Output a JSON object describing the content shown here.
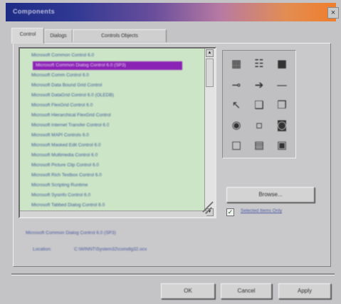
{
  "window": {
    "title": "Components",
    "close_glyph": "×"
  },
  "tabs": [
    {
      "label": "Control"
    },
    {
      "label": "Dialogs"
    },
    {
      "label": "Controls Objects"
    }
  ],
  "list": {
    "items": [
      "Microsoft Common Control 6.0",
      "Microsoft Common Dialog Control 6.0 (SP3)",
      "Microsoft Comm Control 6.0",
      "Microsoft Data Bound Grid Control",
      "Microsoft DataGrid Control 6.0 (OLEDB)",
      "Microsoft FlexGrid Control 6.0",
      "Microsoft Hierarchical FlexGrid Control",
      "Microsoft Internet Transfer Control 6.0",
      "Microsoft MAPI Controls 6.0",
      "Microsoft Masked Edit Control 6.0",
      "Microsoft Multimedia Control 6.0",
      "Microsoft Picture Clip Control 6.0",
      "Microsoft Rich Textbox Control 6.0",
      "Microsoft Scripting Runtime",
      "Microsoft Sysinfo Control 6.0",
      "Microsoft Tabbed Dialog Control 6.0"
    ],
    "selected_index": 1
  },
  "icons": [
    "grid-icon",
    "toolbar-icon",
    "image-icon",
    "slider-icon",
    "arrow-icon",
    "line-icon",
    "cursor-icon",
    "document-icon",
    "stack-icon",
    "globe-icon",
    "blank-icon",
    "chart-icon",
    "empty-icon",
    "table-icon",
    "window-icon"
  ],
  "buttons": {
    "browse": "Browse...",
    "ok": "OK",
    "cancel": "Cancel",
    "apply": "Apply"
  },
  "checkbox": {
    "label": "Selected Items Only",
    "checked": true
  },
  "info": {
    "name": "Microsoft Common Dialog Control 6.0 (SP3)",
    "location_label": "Location:",
    "location_value": "C:\\WINNT\\System32\\comdlg32.ocx"
  },
  "colors": {
    "selection": "#8b22b6",
    "list_background": "#cce5c6",
    "title_start": "#1d2c86",
    "title_end": "#f07d2c"
  }
}
